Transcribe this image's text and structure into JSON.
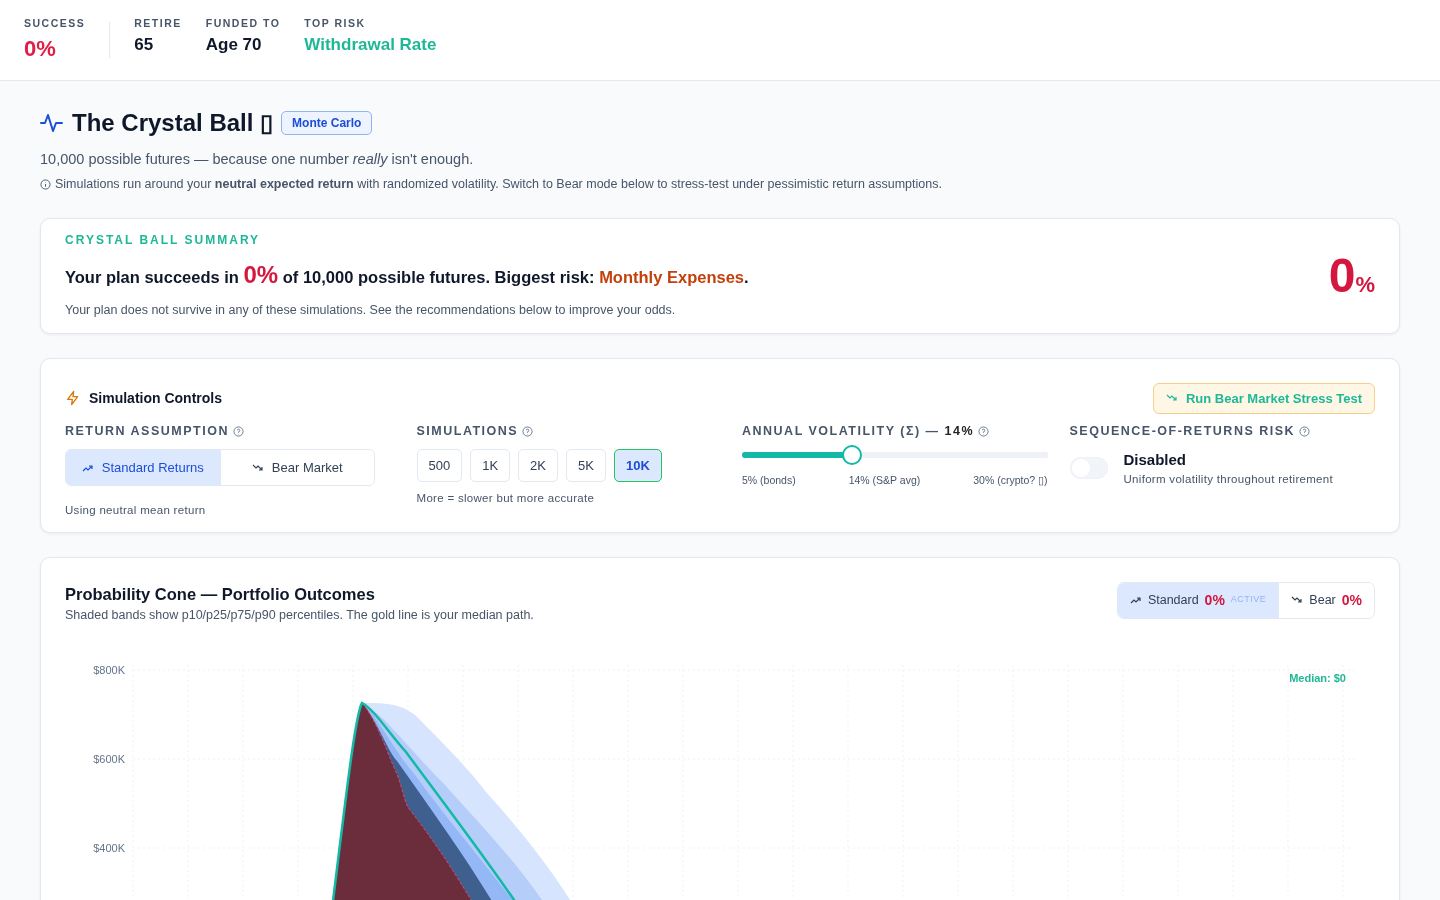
{
  "header_stats": [
    {
      "label": "SUCCESS",
      "value": "0%",
      "kind": "danger"
    },
    {
      "label": "RETIRE",
      "value": "65",
      "kind": "plain"
    },
    {
      "label": "FUNDED TO",
      "value": "Age 70",
      "kind": "plain"
    },
    {
      "label": "TOP RISK",
      "value": "Withdrawal Rate",
      "kind": "accent"
    }
  ],
  "page_header": {
    "title": "The Crystal Ball",
    "title_glyph": "▯",
    "badge": "Monte Carlo",
    "subtitle": "10,000 possible futures — because one number *really* isn't enough.",
    "note": "Simulations run around your **neutral expected return** with randomized volatility. Switch to Bear mode below to stress-test under pessimistic return assumptions."
  },
  "summary": {
    "eyebrow": "CRYSTAL BALL SUMMARY",
    "prefix": "Your plan succeeds in",
    "rate": "0%",
    "middle": "of 10,000 possible futures. Biggest risk:",
    "risk": "Monthly Expenses",
    "suffix": ".",
    "detail": "Your plan does not survive in any of these simulations. See the recommendations below to improve your odds.",
    "big_value": "0",
    "big_unit": "%"
  },
  "controls": {
    "title": "Simulation Controls",
    "stress_button": "Run Bear Market Stress Test",
    "return_assumption": {
      "label": "RETURN ASSUMPTION",
      "options": [
        {
          "label": "Standard Returns",
          "kind": "up",
          "selected": true
        },
        {
          "label": "Bear Market",
          "kind": "down",
          "selected": false
        }
      ],
      "hint": "Using neutral mean return"
    },
    "simulations": {
      "label": "SIMULATIONS",
      "options": [
        {
          "label": "500",
          "selected": false
        },
        {
          "label": "1K",
          "selected": false
        },
        {
          "label": "2K",
          "selected": false
        },
        {
          "label": "5K",
          "selected": false
        },
        {
          "label": "10K",
          "selected": true
        }
      ],
      "hint": "More = slower but more accurate"
    },
    "volatility": {
      "label": "ANNUAL VOLATILITY (Σ) —",
      "value": "14%",
      "level": 0.36,
      "scale": [
        "5% (bonds)",
        "14% (S&P avg)",
        "30% (crypto? ▯)"
      ]
    },
    "sequence_risk": {
      "label": "SEQUENCE-OF-RETURNS RISK",
      "on": false,
      "state_text": "Disabled",
      "hint": "Uniform volatility throughout retirement"
    }
  },
  "chart_card": {
    "title": "Probability Cone — Portfolio Outcomes",
    "subtitle": "Shaded bands show p10/p25/p75/p90 percentiles. The gold line is your median path.",
    "scenarios": [
      {
        "label": "Standard",
        "kind": "up",
        "rate": "0%",
        "selected": true,
        "badge": "ACTIVE"
      },
      {
        "label": "Bear",
        "kind": "down",
        "rate": "0%",
        "selected": false
      }
    ],
    "y_axis_labels": [
      "$800K",
      "$600K",
      "$400K"
    ],
    "median_label": "Median: $0"
  }
}
